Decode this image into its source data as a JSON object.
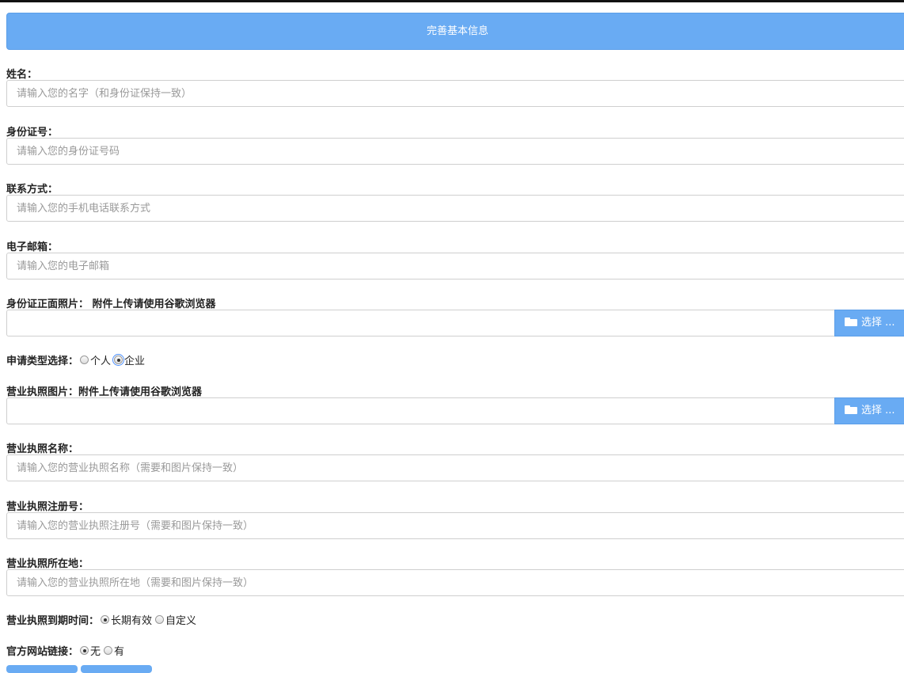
{
  "header": {
    "title": "完善基本信息"
  },
  "fields": {
    "name": {
      "label": "姓名：",
      "placeholder": "请输入您的名字（和身份证保持一致）"
    },
    "id_number": {
      "label": "身份证号：",
      "placeholder": "请输入您的身份证号码"
    },
    "contact": {
      "label": "联系方式：",
      "placeholder": "请输入您的手机电话联系方式"
    },
    "email": {
      "label": "电子邮箱：",
      "placeholder": "请输入您的电子邮箱"
    },
    "id_photo": {
      "label": "身份证正面照片： 附件上传请使用谷歌浏览器",
      "button": "选择 ..."
    },
    "apply_type": {
      "label": "申请类型选择：",
      "options": [
        "个人",
        "企业"
      ],
      "selected": "企业"
    },
    "license_photo": {
      "label": "营业执照图片：附件上传请使用谷歌浏览器",
      "button": "选择 ..."
    },
    "license_name": {
      "label": "营业执照名称：",
      "placeholder": "请输入您的营业执照名称（需要和图片保持一致）"
    },
    "license_reg_no": {
      "label": "营业执照注册号：",
      "placeholder": "请输入您的营业执照注册号（需要和图片保持一致）"
    },
    "license_location": {
      "label": "营业执照所在地：",
      "placeholder": "请输入您的营业执照所在地（需要和图片保持一致）"
    },
    "license_expiry": {
      "label": "营业执照到期时间：",
      "options": [
        "长期有效",
        "自定义"
      ],
      "selected": "长期有效"
    },
    "website": {
      "label": "官方网站链接：",
      "options": [
        "无",
        "有"
      ],
      "selected": "无"
    }
  },
  "colors": {
    "accent": "#69abf3"
  }
}
